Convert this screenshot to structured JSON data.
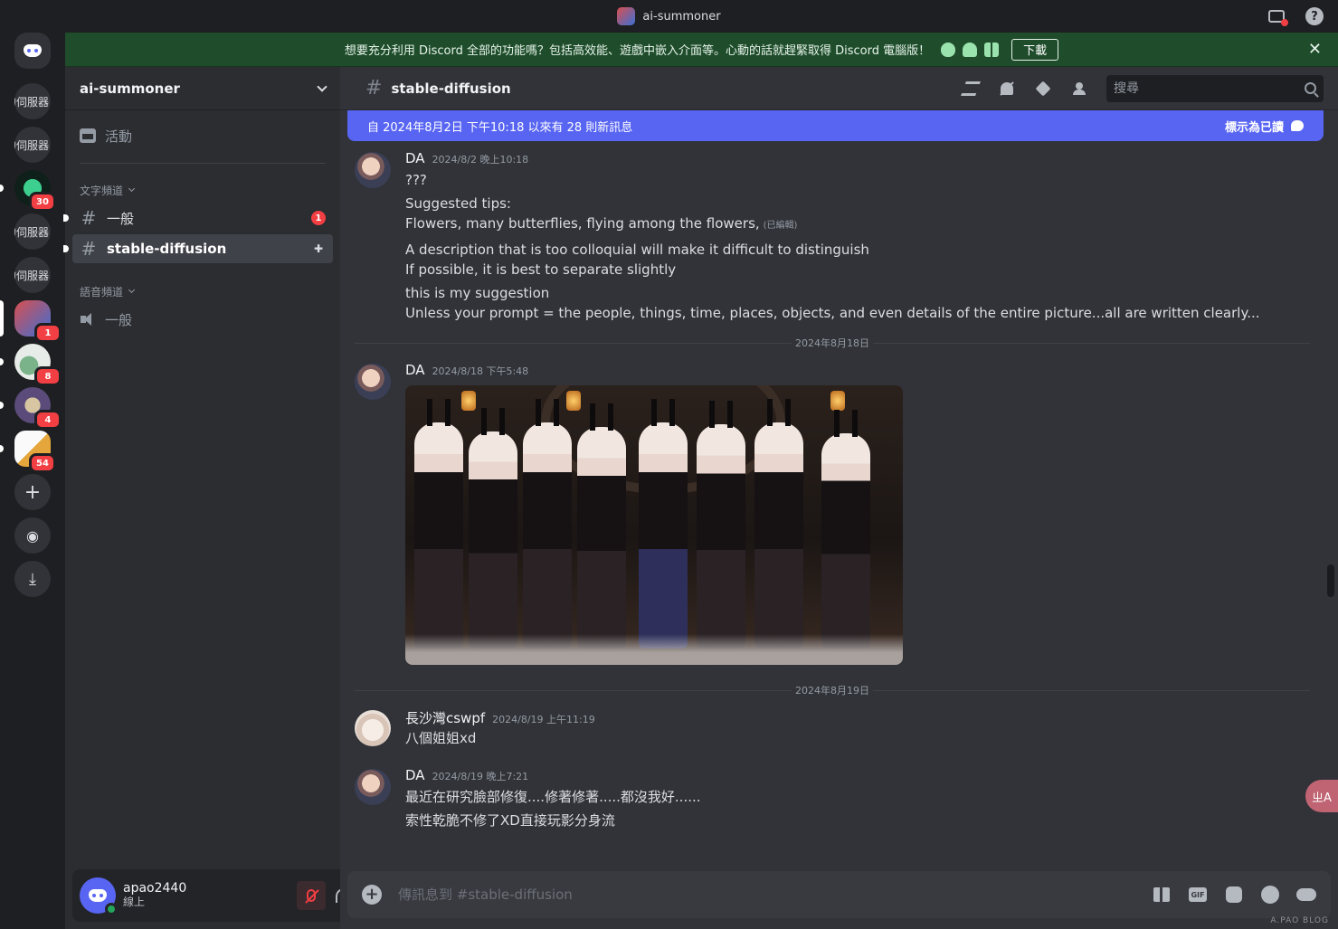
{
  "window": {
    "title": "ai-summoner"
  },
  "banner": {
    "text": "想要充分利用 Discord 全部的功能嗎？包括高效能、遊戲中嵌入介面等。心動的話就趕緊取得 Discord 電腦版！",
    "download_label": "下載"
  },
  "rail": {
    "text_servers": [
      "的伺服器",
      "的伺服器",
      "的伺服器",
      "的伺服器"
    ],
    "badges": [
      "30",
      "1",
      "8",
      "4",
      "54"
    ]
  },
  "guild": {
    "name": "ai-summoner",
    "events_label": "活動",
    "text_category": "文字頻道",
    "voice_category": "語音頻道",
    "channels": [
      {
        "name": "一般",
        "badge": "1"
      },
      {
        "name": "stable-diffusion"
      }
    ],
    "voice_channels": [
      {
        "name": "一般"
      }
    ]
  },
  "user": {
    "name": "apao2440",
    "status": "線上"
  },
  "channel": {
    "name": "stable-diffusion",
    "search_placeholder": "搜尋"
  },
  "new_messages_bar": {
    "text": "自 2024年8月2日 下午10:18 以來有 28 則新訊息",
    "mark_read": "標示為已讀"
  },
  "messages": [
    {
      "author": "DA",
      "timestamp": "2024/8/2 晚上10:18",
      "lines": [
        "???",
        "Suggested tips:",
        "Flowers, many butterflies, flying among the flowers,",
        "A description that is too colloquial will make it difficult to distinguish",
        "If possible, it is best to separate slightly",
        "this is my suggestion",
        "Unless your prompt = the people, things, time, places, objects, and even details of the entire picture...all are written clearly..."
      ],
      "edited_label": "(已編輯)"
    },
    {
      "divider": "2024年8月18日"
    },
    {
      "author": "DA",
      "timestamp": "2024/8/18 下午5:48",
      "attachment": "image"
    },
    {
      "divider": "2024年8月19日"
    },
    {
      "author": "長沙灣cswpf",
      "timestamp": "2024/8/19 上午11:19",
      "lines": [
        "八個姐姐xd"
      ]
    },
    {
      "author": "DA",
      "timestamp": "2024/8/19 晚上7:21",
      "lines": [
        "最近在研究臉部修復....修著修著.....都沒我好......",
        "索性乾脆不修了XD直接玩影分身流"
      ]
    }
  ],
  "composer": {
    "placeholder": "傳訊息到 #stable-diffusion"
  },
  "floating": {
    "translate_label": "ㄓA"
  },
  "watermark": "A.PAO BLOG",
  "colors": {
    "accent": "#5865f2",
    "banner_bg": "#1f4d2b",
    "unread_badge": "#f23f43",
    "online": "#23a55a"
  }
}
